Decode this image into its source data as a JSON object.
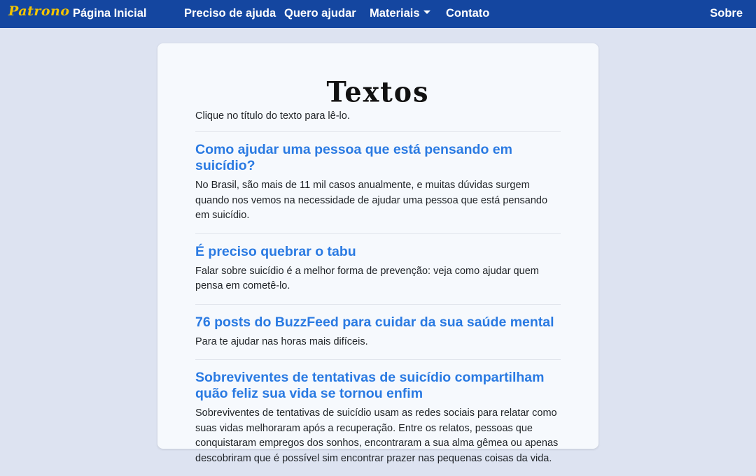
{
  "nav": {
    "brand": "Patrono",
    "links": {
      "home": "Página Inicial",
      "help": "Preciso de ajuda",
      "volunteer": "Quero ajudar",
      "materials": "Materiais",
      "contact": "Contato",
      "about": "Sobre"
    }
  },
  "colors": {
    "navbar": "#1446a0",
    "brand": "#f2c400",
    "link": "#2a7ae2",
    "background": "#dde3f1"
  },
  "page": {
    "title": "Textos",
    "intro": "Clique no título do texto para lê-lo."
  },
  "articles": [
    {
      "title": "Como ajudar uma pessoa que está pensando em suicídio?",
      "description": "No Brasil, são mais de 11 mil casos anualmente, e muitas dúvidas surgem quando nos vemos na necessidade de ajudar uma pessoa que está pensando em suicídio."
    },
    {
      "title": "É preciso quebrar o tabu",
      "description": "Falar sobre suicídio é a melhor forma de prevenção: veja como ajudar quem pensa em cometê-lo."
    },
    {
      "title": "76 posts do BuzzFeed para cuidar da sua saúde mental",
      "description": "Para te ajudar nas horas mais difíceis."
    },
    {
      "title": "Sobreviventes de tentativas de suicídio compartilham quão feliz sua vida se tornou enfim",
      "description": "Sobreviventes de tentativas de suicídio usam as redes sociais para relatar como suas vidas melhoraram após a recuperação. Entre os relatos, pessoas que conquistaram empregos dos sonhos, encontraram a sua alma gêmea ou apenas descobriram que é possível sim encontrar prazer nas pequenas coisas da vida."
    }
  ]
}
